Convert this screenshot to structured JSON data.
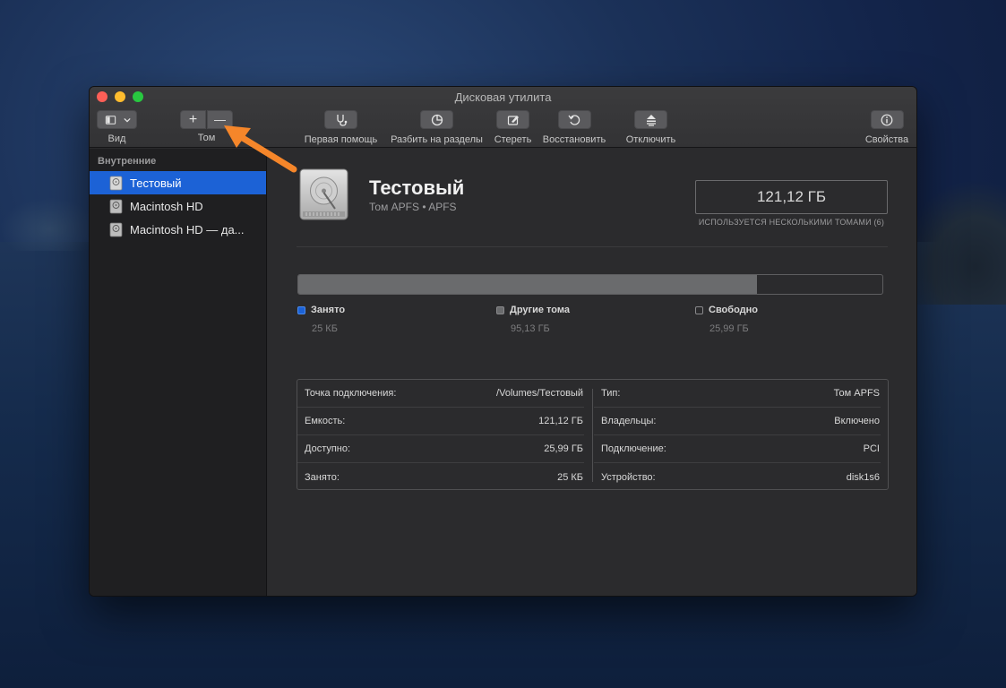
{
  "window": {
    "title": "Дисковая утилита"
  },
  "toolbar": {
    "view_label": "Вид",
    "volume_label": "Том",
    "add_symbol": "+",
    "remove_symbol": "—",
    "first_aid_label": "Первая помощь",
    "partition_label": "Разбить на разделы",
    "erase_label": "Стереть",
    "restore_label": "Восстановить",
    "unmount_label": "Отключить",
    "info_label": "Свойства"
  },
  "sidebar": {
    "section": "Внутренние",
    "items": [
      {
        "label": "Тестовый",
        "selected": true
      },
      {
        "label": "Macintosh HD",
        "selected": false
      },
      {
        "label": "Macintosh HD — да...",
        "selected": false
      }
    ]
  },
  "volume": {
    "name": "Тестовый",
    "subtitle": "Том APFS • APFS",
    "capacity": "121,12 ГБ",
    "shared_note": "ИСПОЛЬЗУЕТСЯ НЕСКОЛЬКИМИ ТОМАМИ (6)"
  },
  "usage": {
    "used_fraction": 0.0002,
    "other_fraction": 0.785,
    "legend": [
      {
        "label": "Занято",
        "value": "25 КБ",
        "color": "#1c62d6"
      },
      {
        "label": "Другие тома",
        "value": "95,13 ГБ",
        "color": "#6a6b6d"
      },
      {
        "label": "Свободно",
        "value": "25,99 ГБ",
        "color": "#2b2b2d"
      }
    ]
  },
  "details": {
    "left": [
      {
        "key": "Точка подключения:",
        "value": "/Volumes/Тестовый"
      },
      {
        "key": "Емкость:",
        "value": "121,12 ГБ"
      },
      {
        "key": "Доступно:",
        "value": "25,99 ГБ"
      },
      {
        "key": "Занято:",
        "value": "25 КБ"
      }
    ],
    "right": [
      {
        "key": "Тип:",
        "value": "Том APFS"
      },
      {
        "key": "Владельцы:",
        "value": "Включено"
      },
      {
        "key": "Подключение:",
        "value": "PCI"
      },
      {
        "key": "Устройство:",
        "value": "disk1s6"
      }
    ]
  },
  "colors": {
    "accent": "#1c62d6",
    "annotation_arrow": "#f5862a"
  }
}
